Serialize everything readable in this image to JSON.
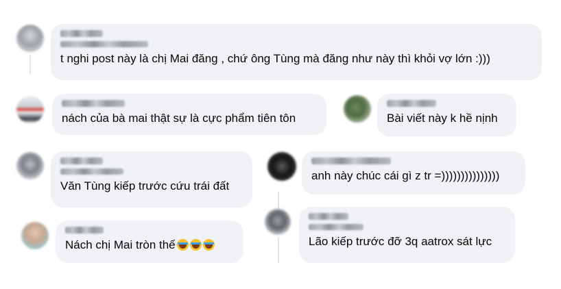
{
  "comments": [
    {
      "name": "",
      "subname": "",
      "text": "t nghi post này là chị Mai đăng , chứ ông Tùng mà đăng như này thì khỏi vợ lớn :)))",
      "emoji_count": 0
    },
    {
      "name": "",
      "subname": "",
      "text": "nách của bà mai thật sự là cực phẩm tiên tôn",
      "emoji_count": 0
    },
    {
      "name": "",
      "subname": "",
      "text": "Bài viết này k hề nịnh",
      "emoji_count": 0
    },
    {
      "name": "",
      "subname": "",
      "text": "Văn Tùng kiếp trước cứu trái đất",
      "emoji_count": 0
    },
    {
      "name": "",
      "subname": "",
      "text": "anh này chúc cái gì z tr =)))))))))))))))",
      "emoji_count": 0
    },
    {
      "name": "",
      "subname": "",
      "text": "Nách chị Mai tròn thế",
      "emoji_count": 3,
      "emoji_icon": "tears-of-joy-icon"
    },
    {
      "name": "",
      "subname": "",
      "text": "Lão kiếp trước đỡ 3q aatrox sát lực",
      "emoji_count": 0
    }
  ],
  "colors": {
    "bubble": "#f0f2f5",
    "text": "#050505",
    "thread_line": "#e4e6eb"
  }
}
